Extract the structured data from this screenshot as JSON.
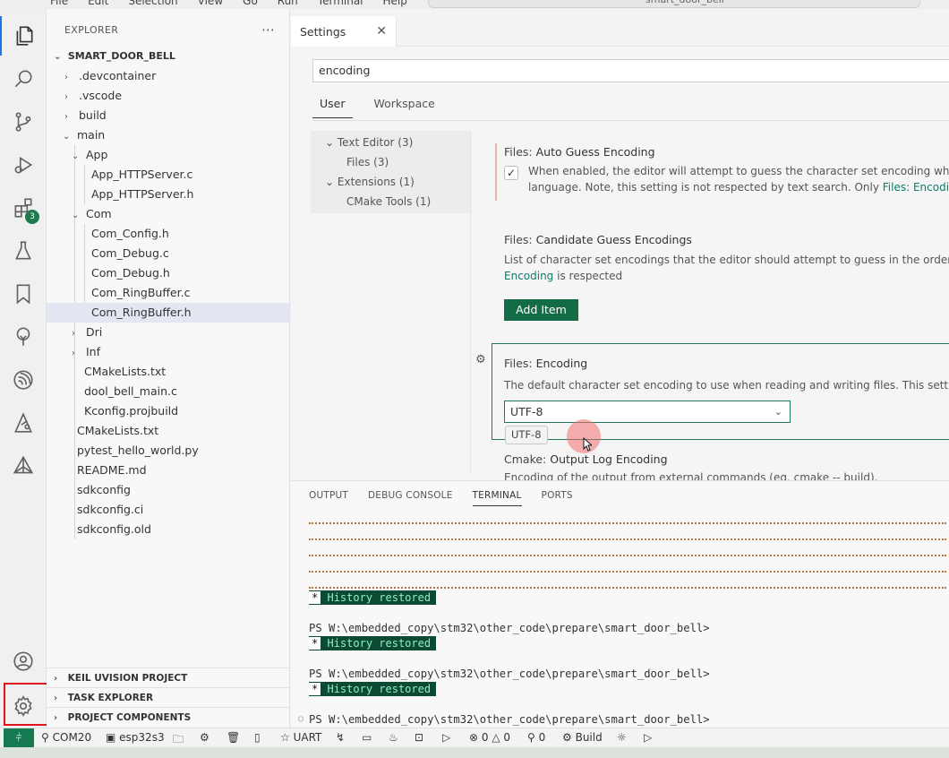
{
  "titlebar": {
    "menu": [
      "File",
      "Edit",
      "Selection",
      "View",
      "Go",
      "Run",
      "Terminal",
      "Help"
    ],
    "command_center": "smart_door_bell"
  },
  "activity_bar": {
    "items": [
      "explorer-icon",
      "search-icon",
      "source-control-icon",
      "run-debug-icon",
      "extensions-icon",
      "testing-icon",
      "bookmarks-icon",
      "tree-icon",
      "espressif-icon",
      "keil-icon",
      "cmake-icon"
    ],
    "extensions_badge": "3",
    "bottom": [
      "account-icon",
      "settings-gear-icon"
    ]
  },
  "explorer": {
    "header": "EXPLORER",
    "more": "⋯",
    "root": "SMART_DOOR_BELL",
    "items": [
      {
        "label": ".devcontainer",
        "chev": "›"
      },
      {
        "label": ".vscode",
        "chev": "›"
      },
      {
        "label": "build",
        "chev": "›"
      },
      {
        "label": "main",
        "chev": "⌄"
      },
      {
        "label": "App",
        "chev": "⌄"
      },
      {
        "label": "App_HTTPServer.c",
        "chev": ""
      },
      {
        "label": "App_HTTPServer.h",
        "chev": ""
      },
      {
        "label": "Com",
        "chev": "⌄"
      },
      {
        "label": "Com_Config.h",
        "chev": ""
      },
      {
        "label": "Com_Debug.c",
        "chev": ""
      },
      {
        "label": "Com_Debug.h",
        "chev": ""
      },
      {
        "label": "Com_RingBuffer.c",
        "chev": ""
      },
      {
        "label": "Com_RingBuffer.h",
        "chev": ""
      },
      {
        "label": "Dri",
        "chev": "›"
      },
      {
        "label": "Inf",
        "chev": "›"
      },
      {
        "label": "CMakeLists.txt",
        "chev": ""
      },
      {
        "label": "dool_bell_main.c",
        "chev": ""
      },
      {
        "label": "Kconfig.projbuild",
        "chev": ""
      },
      {
        "label": "CMakeLists.txt",
        "chev": ""
      },
      {
        "label": "pytest_hello_world.py",
        "chev": ""
      },
      {
        "label": "README.md",
        "chev": ""
      },
      {
        "label": "sdkconfig",
        "chev": ""
      },
      {
        "label": "sdkconfig.ci",
        "chev": ""
      },
      {
        "label": "sdkconfig.old",
        "chev": ""
      }
    ],
    "sections": [
      "KEIL UVISION PROJECT",
      "TASK EXPLORER",
      "PROJECT COMPONENTS"
    ]
  },
  "editor": {
    "tab_label": "Settings",
    "tab_close": "✕",
    "search_value": "encoding",
    "scope_tabs": [
      "User",
      "Workspace"
    ],
    "toc": [
      "Text Editor (3)",
      "Files (3)",
      "Extensions (1)",
      "CMake Tools (1)"
    ],
    "settings": [
      {
        "category": "Files: ",
        "name": "Auto Guess Encoding",
        "desc_line1": "When enabled, the editor will attempt to guess the character set encoding when",
        "desc_line2_pre": "language. Note, this setting is not respected by text search. Only ",
        "desc_line2_link": "Files: Encoding",
        "checked": "✓"
      },
      {
        "category": "Files: ",
        "name": "Candidate Guess Encodings",
        "desc_line1": "List of character set encodings that the editor should attempt to guess in the order th",
        "desc_line2_link": "Encoding",
        "desc_line2_post": " is respected",
        "button": "Add Item"
      },
      {
        "category": "Files: ",
        "name": "Encoding",
        "desc_line1": "The default character set encoding to use when reading and writing files. This setting",
        "value": "UTF-8",
        "tooltip": "UTF-8"
      },
      {
        "category": "Cmake: ",
        "name": "Output Log Encoding",
        "desc_line1": "Encoding of the output from external commands (eg. cmake -- build)."
      }
    ]
  },
  "panel": {
    "tabs": [
      "OUTPUT",
      "DEBUG CONSOLE",
      "TERMINAL",
      "PORTS"
    ],
    "history_star": "*",
    "history_text": "History restored",
    "prompt": "PS W:\\embedded_copy\\stm32\\other_code\\prepare\\smart_door_bell>"
  },
  "statusbar": {
    "remote": "⫩",
    "port": "COM20",
    "target": "esp32s3",
    "uart": "UART",
    "errors": "0",
    "warnings": "0",
    "ports_count": "0",
    "build": "Build"
  },
  "colors": {
    "accent_green": "#136c45",
    "link": "#0f7a6a",
    "highlight_box": "#e0141e",
    "terminal_dots": "#b9763f"
  }
}
